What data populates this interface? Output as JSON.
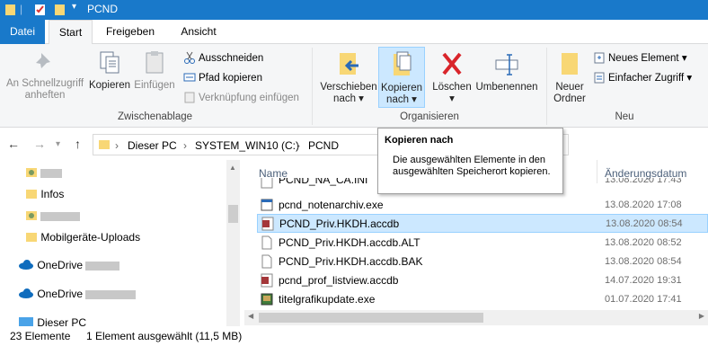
{
  "window": {
    "title": "PCND"
  },
  "tabs": {
    "file": "Datei",
    "start": "Start",
    "share": "Freigeben",
    "view": "Ansicht"
  },
  "ribbon": {
    "pin": "An Schnellzugriff\nanheften",
    "copy": "Kopieren",
    "paste": "Einfügen",
    "cut": "Ausschneiden",
    "copy_path": "Pfad kopieren",
    "paste_shortcut": "Verknüpfung einfügen",
    "group_clipboard": "Zwischenablage",
    "move_to": "Verschieben\nnach ▾",
    "copy_to": "Kopieren\nnach ▾",
    "delete": "Löschen\n▾",
    "rename": "Umbenennen",
    "group_organize": "Organisieren",
    "new_folder": "Neuer\nOrdner",
    "new_item": "Neues Element ▾",
    "easy_access": "Einfacher Zugriff ▾",
    "group_new": "Neu"
  },
  "address": {
    "pc": "Dieser PC",
    "drive": "SYSTEM_WIN10 (C:)",
    "folder": "PCND"
  },
  "left": {
    "items": [
      "Infos",
      "Mobilgeräte-Uploads",
      "OneDrive",
      "OneDrive",
      "Dieser PC"
    ]
  },
  "columns": {
    "name": "Name",
    "date": "Änderungsdatum"
  },
  "files": [
    {
      "name": "PCND_NA_CA.INI",
      "date": "13.08.2020 17:43"
    },
    {
      "name": "pcnd_notenarchiv.exe",
      "date": "13.08.2020 17:08"
    },
    {
      "name": "PCND_Priv.HKDH.accdb",
      "date": "13.08.2020 08:54"
    },
    {
      "name": "PCND_Priv.HKDH.accdb.ALT",
      "date": "13.08.2020 08:52"
    },
    {
      "name": "PCND_Priv.HKDH.accdb.BAK",
      "date": "13.08.2020 08:54"
    },
    {
      "name": "pcnd_prof_listview.accdb",
      "date": "14.07.2020 19:31"
    },
    {
      "name": "titelgrafikupdate.exe",
      "date": "01.07.2020 17:41"
    }
  ],
  "status": {
    "count": "23 Elemente",
    "selected": "1 Element ausgewählt (11,5 MB)"
  },
  "tooltip": {
    "title": "Kopieren nach",
    "desc": "Die ausgewählten Elemente in den ausgewählten Speicherort kopieren."
  },
  "colors": {
    "accent": "#1979ca",
    "selection": "#cce8ff",
    "folder": "#f8d775"
  }
}
